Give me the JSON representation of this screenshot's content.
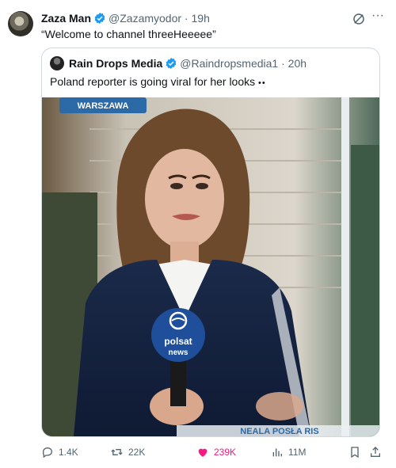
{
  "tweet": {
    "author_name": "Zaza Man",
    "author_handle": "@Zazamyodor",
    "time": "19h",
    "text": "“Welcome to channel threeHeeeee”",
    "more_label": "···"
  },
  "quote": {
    "author_name": "Rain Drops Media",
    "author_handle": "@Raindropsmedia1",
    "time": "20h",
    "text": "Poland  reporter is going viral for her looks",
    "text_emoji": "••"
  },
  "media": {
    "location_banner": "WARSZAWA",
    "mic_brand_line1": "polsat",
    "mic_brand_line2": "news",
    "bottom_ticker": "NEALA POSŁA RIS"
  },
  "actions": {
    "replies": "1.4K",
    "reposts": "22K",
    "likes": "239K",
    "views": "11M"
  },
  "colors": {
    "verified": "#1d9bf0",
    "like": "#f91880",
    "muted": "#536471",
    "border": "#cfd9de"
  },
  "icons": [
    "verified-badge-icon",
    "grok-icon",
    "more-icon",
    "reply-icon",
    "repost-icon",
    "like-icon",
    "views-icon",
    "bookmark-icon",
    "share-icon"
  ]
}
